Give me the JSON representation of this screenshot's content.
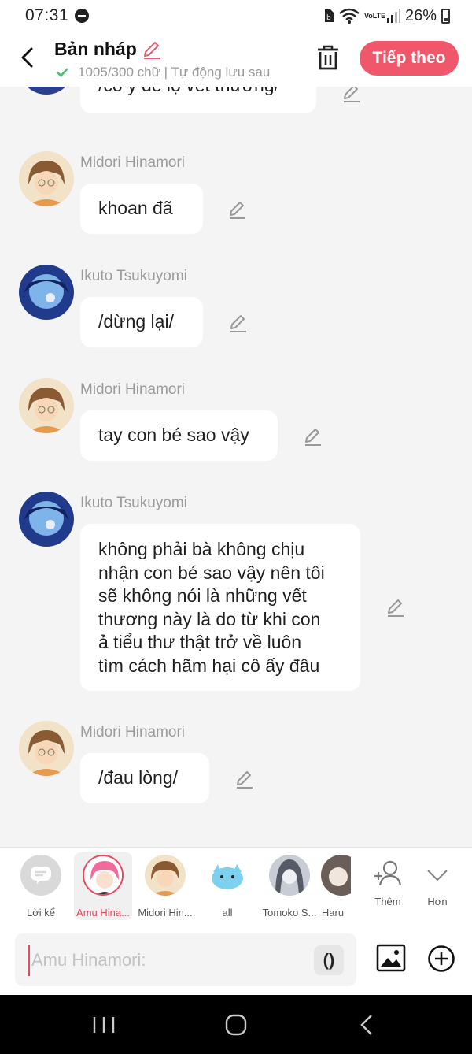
{
  "status": {
    "time": "07:31",
    "battery": "26%",
    "network": "VoLTE"
  },
  "header": {
    "title": "Bản nháp",
    "subtitle": "1005/300 chữ | Tự động lưu sau",
    "next_label": "Tiếp theo"
  },
  "messages": [
    {
      "speaker": "",
      "text": "/cố ý để lộ vết thương/",
      "avatar": "ikuto"
    },
    {
      "speaker": "Midori Hinamori",
      "text": "khoan đã",
      "avatar": "midori"
    },
    {
      "speaker": "Ikuto Tsukuyomi",
      "text": "/dừng lại/",
      "avatar": "ikuto"
    },
    {
      "speaker": "Midori Hinamori",
      "text": "tay con bé sao vậy",
      "avatar": "midori"
    },
    {
      "speaker": "Ikuto Tsukuyomi",
      "text": "không phải bà không chịu nhận con bé sao vậy nên tôi sẽ không nói là những vết thương này là do từ khi con ả tiểu thư thật trở về luôn tìm cách hãm hại cô ấy đâu",
      "lines": [
        "không phải bà không chịu",
        "nhận con bé sao vậy nên tôi",
        "sẽ không nói là những vết",
        "thương này là do từ khi con",
        "ả tiểu thư thật trở về luôn",
        "tìm cách hãm hại cô ấy đâu"
      ],
      "avatar": "ikuto"
    },
    {
      "speaker": "Midori Hinamori",
      "text": "/đau lòng/",
      "avatar": "midori"
    }
  ],
  "characters": [
    {
      "label": "Lời kể",
      "icon": "narration-icon"
    },
    {
      "label": "Amu Hina...",
      "icon": "avatar-amu",
      "selected": true
    },
    {
      "label": "Midori Hin...",
      "icon": "avatar-midori"
    },
    {
      "label": "all",
      "icon": "avatar-all"
    },
    {
      "label": "Tomoko S...",
      "icon": "avatar-tomoko"
    },
    {
      "label": "Haru",
      "icon": "avatar-haru"
    },
    {
      "label": "Thêm",
      "icon": "add-person-icon"
    },
    {
      "label": "Hơn",
      "icon": "chevron-down-icon"
    }
  ],
  "input": {
    "placeholder": "Amu Hinamori:",
    "paren_label": "()"
  },
  "colors": {
    "accent": "#f1576b",
    "name": "#9b9b9b",
    "bubble": "#ffffff",
    "background": "#f4f4f4",
    "check": "#4cbf73"
  }
}
